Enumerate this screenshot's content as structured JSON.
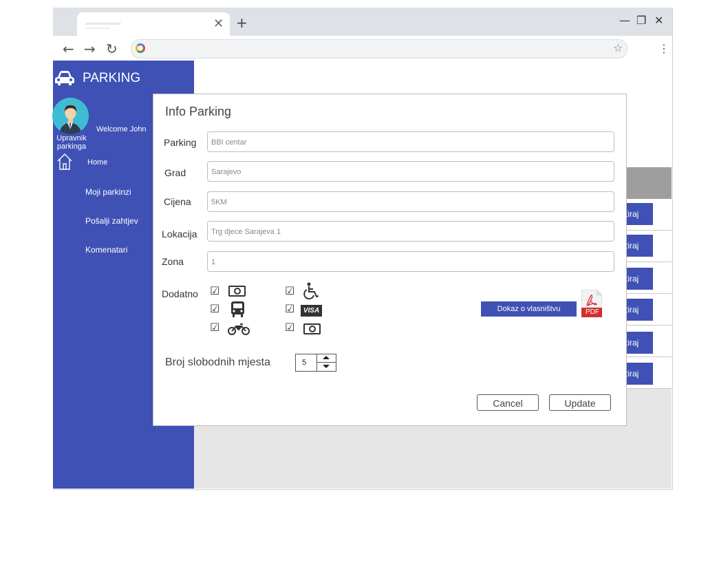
{
  "browser": {
    "tab_close": "✕",
    "new_tab": "+",
    "minimize": "—",
    "maximize": "❐",
    "close": "✕",
    "back": "←",
    "forward": "→",
    "reload": "↻",
    "bookmark": "☆",
    "menu": "⋮"
  },
  "sidebar": {
    "brand": "PARKING",
    "welcome": "Welcome John",
    "role": "Upravnik parkinga",
    "items": [
      {
        "label": "Home"
      },
      {
        "label": "Moji parkinzi"
      },
      {
        "label": "Pošalji zahtjev"
      },
      {
        "label": "Komenatari"
      }
    ]
  },
  "table": {
    "row_button_label": "tiraj",
    "rows": 6
  },
  "modal": {
    "title": "Info Parking",
    "fields": [
      {
        "label": "Parking",
        "value": "BBI centar"
      },
      {
        "label": "Grad",
        "value": "Sarajevo"
      },
      {
        "label": "Cijena",
        "value": "5KM"
      },
      {
        "label": "Lokacija",
        "value": "Trg djece Sarajeva 1"
      },
      {
        "label": "Zona",
        "value": "1"
      }
    ],
    "dodatno_label": "Dodatno",
    "checkbox_mark": "☑",
    "amenities": [
      {
        "icon": "money-icon",
        "checked": true
      },
      {
        "icon": "wheelchair-icon",
        "checked": true
      },
      {
        "icon": "bus-icon",
        "checked": true
      },
      {
        "icon": "visa-icon",
        "checked": true,
        "text": "VISA"
      },
      {
        "icon": "motorcycle-icon",
        "checked": true
      },
      {
        "icon": "money-icon",
        "checked": true
      }
    ],
    "dokaz_button": "Dokaz o vlasništvu",
    "pdf_label": "PDF",
    "broj_label": "Broj slobodnih mjesta",
    "broj_value": "5",
    "cancel": "Cancel",
    "update": "Update"
  },
  "colors": {
    "accent": "#3f51b5",
    "header_grey": "#9e9e9e",
    "content_grey": "#e6e6e6",
    "avatar_bg": "#3fbcd4",
    "pdf_red": "#d32f2f"
  }
}
